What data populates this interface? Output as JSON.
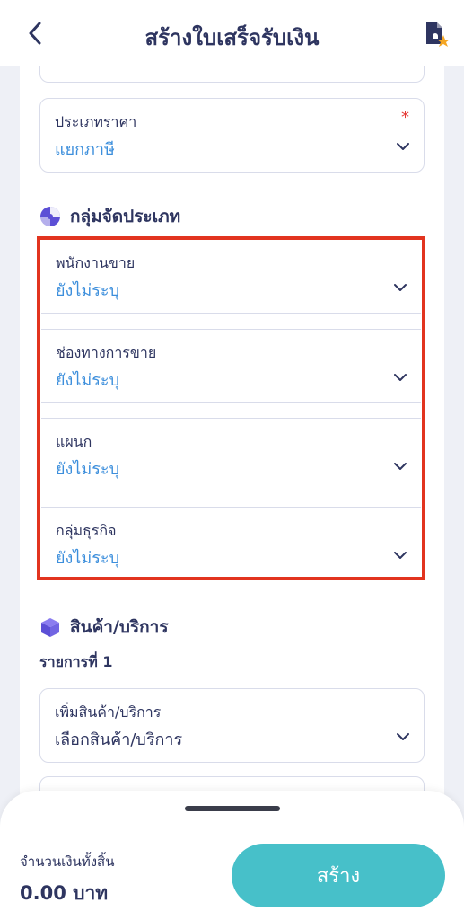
{
  "header": {
    "title": "สร้างใบเสร็จรับเงิน"
  },
  "price_type": {
    "label": "ประเภทราคา",
    "required_mark": "*",
    "value": "แยกภาษี"
  },
  "grouping": {
    "section_title": "กลุ่มจัดประเภท",
    "fields": [
      {
        "label": "พนักงานขาย",
        "value": "ยังไม่ระบุ"
      },
      {
        "label": "ช่องทางการขาย",
        "value": "ยังไม่ระบุ"
      },
      {
        "label": "แผนก",
        "value": "ยังไม่ระบุ"
      },
      {
        "label": "กลุ่มธุรกิจ",
        "value": "ยังไม่ระบุ"
      }
    ]
  },
  "products": {
    "section_title": "สินค้า/บริการ",
    "item_label": "รายการที่ 1",
    "add_label": "เพิ่มสินค้า/บริการ",
    "add_value": "เลือกสินค้า/บริการ"
  },
  "footer": {
    "total_label": "จำนวนเงินทั้งสิ้น",
    "total_value": "0.00 บาท",
    "create_label": "สร้าง"
  },
  "colors": {
    "accent": "#3d8fdc",
    "button": "#47c0c9",
    "highlight": "#e2341f"
  }
}
